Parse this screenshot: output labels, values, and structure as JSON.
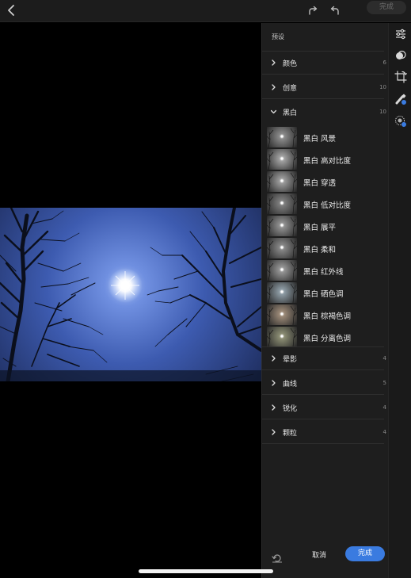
{
  "topbar": {
    "done_label": "完成",
    "icons": [
      "chevron-left-icon",
      "redo-icon",
      "undo-icon"
    ]
  },
  "panel": {
    "title": "预设",
    "categories_top": [
      {
        "label": "颜色",
        "count": "6",
        "expanded": false
      },
      {
        "label": "创意",
        "count": "10",
        "expanded": false
      },
      {
        "label": "黑白",
        "count": "10",
        "expanded": true
      }
    ],
    "bw_presets": [
      {
        "label": "黑白 风景",
        "tint": "#8a8a8a"
      },
      {
        "label": "黑白 高对比度",
        "tint": "#a0a0a0"
      },
      {
        "label": "黑白 穿透",
        "tint": "#9a9a9a"
      },
      {
        "label": "黑白 低对比度",
        "tint": "#7d7d7d"
      },
      {
        "label": "黑白 展平",
        "tint": "#8f8f8f"
      },
      {
        "label": "黑白 柔和",
        "tint": "#868686"
      },
      {
        "label": "黑白 红外线",
        "tint": "#949494"
      },
      {
        "label": "黑白 硒色调",
        "tint": "#8c9aa3"
      },
      {
        "label": "黑白 棕褐色调",
        "tint": "#9a8876"
      },
      {
        "label": "黑白 分离色调",
        "tint": "#8a8c72"
      }
    ],
    "categories_bottom": [
      {
        "label": "晕影",
        "count": "4",
        "expanded": false
      },
      {
        "label": "曲线",
        "count": "5",
        "expanded": false
      },
      {
        "label": "锐化",
        "count": "4",
        "expanded": false
      },
      {
        "label": "颗粒",
        "count": "4",
        "expanded": false
      }
    ],
    "cancel_label": "取消",
    "done_label": "完成"
  },
  "toolbar": {
    "tools": [
      "sliders-icon",
      "presets-icon",
      "crop-rotate-icon",
      "healing-brush-icon",
      "selective-edit-icon"
    ]
  },
  "colors": {
    "accent": "#3a7be0",
    "panel_bg": "#1e1e1e",
    "sky_center": "#9fb6f0",
    "sky_edge": "#22315f"
  }
}
